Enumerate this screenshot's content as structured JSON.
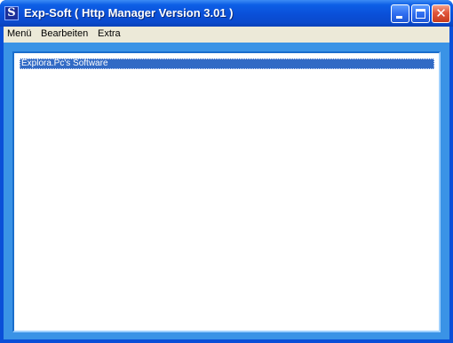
{
  "window": {
    "icon_letter": "S",
    "title": "Exp-Soft ( Http Manager Version 3.01 )",
    "buttons": [
      "minimize",
      "maximize",
      "close"
    ],
    "close_glyph": "✕",
    "colors": {
      "titlebar": "#0a4fd8",
      "client": "#3a93e6",
      "selection": "#316ac5",
      "close_button": "#e0553a"
    }
  },
  "menubar": {
    "items": [
      "Menü",
      "Bearbeiten",
      "Extra"
    ]
  },
  "list": {
    "items": [
      {
        "label": "Explora.Pc's Software",
        "selected": true
      }
    ]
  }
}
